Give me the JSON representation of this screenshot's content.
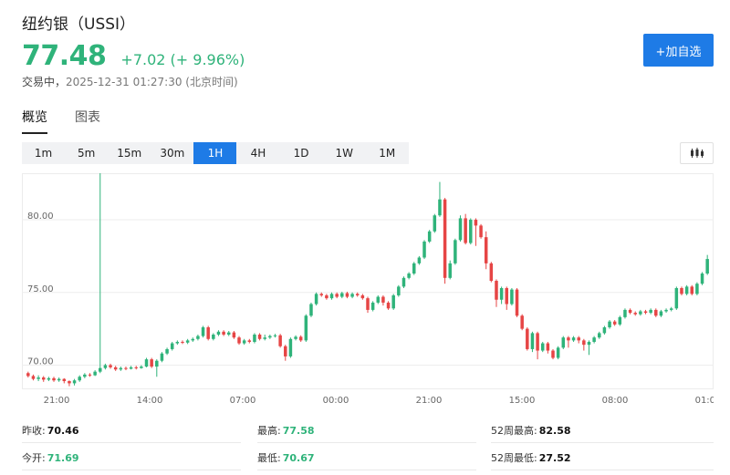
{
  "header": {
    "title": "纽约银（USSI）",
    "price": "77.48",
    "change": "+7.02 (+ 9.96%)",
    "status_label": "交易中，",
    "status_time": "2025-12-31 01:27:30 (北京时间)",
    "add_button": "+加自选"
  },
  "tabs": [
    {
      "label": "概览",
      "active": true
    },
    {
      "label": "图表",
      "active": false
    }
  ],
  "intervals": [
    "1m",
    "5m",
    "15m",
    "30m",
    "1H",
    "4H",
    "1D",
    "1W",
    "1M"
  ],
  "active_interval": "1H",
  "colors": {
    "up": "#2fb37a",
    "down": "#e64545",
    "accent": "#1e7be6"
  },
  "chart_data": {
    "type": "candlestick",
    "y_ticks": [
      "80.00",
      "75.00",
      "70.00"
    ],
    "x_ticks": [
      "21:00",
      "14:00",
      "07:00",
      "00:00",
      "21:00",
      "15:00",
      "08:00",
      "01:00"
    ],
    "ylim": [
      68.4,
      83.2
    ],
    "grid": true,
    "ohlc": [
      [
        69.45,
        69.25,
        69.55,
        69.15
      ],
      [
        69.25,
        69.05,
        69.35,
        68.95
      ],
      [
        69.05,
        69.15,
        69.3,
        68.9
      ],
      [
        69.15,
        69.0,
        69.25,
        68.85
      ],
      [
        69.0,
        69.1,
        69.2,
        68.9
      ],
      [
        69.1,
        68.95,
        69.2,
        68.85
      ],
      [
        68.95,
        69.05,
        69.15,
        68.85
      ],
      [
        69.05,
        68.9,
        69.1,
        68.75
      ],
      [
        68.9,
        68.75,
        68.95,
        68.55
      ],
      [
        68.75,
        68.95,
        69.05,
        68.6
      ],
      [
        68.95,
        69.2,
        69.3,
        68.85
      ],
      [
        69.2,
        69.35,
        69.45,
        69.1
      ],
      [
        69.35,
        69.3,
        69.45,
        69.2
      ],
      [
        69.3,
        69.55,
        69.65,
        69.25
      ],
      [
        69.55,
        69.8,
        89.9,
        69.45
      ],
      [
        69.8,
        70.0,
        70.1,
        69.7
      ],
      [
        70.0,
        69.85,
        70.1,
        69.75
      ],
      [
        69.85,
        69.7,
        69.95,
        69.6
      ],
      [
        69.7,
        69.8,
        69.9,
        69.6
      ],
      [
        69.8,
        69.75,
        69.9,
        69.65
      ],
      [
        69.75,
        69.85,
        69.95,
        69.7
      ],
      [
        69.85,
        69.8,
        69.95,
        69.7
      ],
      [
        69.8,
        69.9,
        70.0,
        69.75
      ],
      [
        69.9,
        70.4,
        70.5,
        69.85
      ],
      [
        70.4,
        69.9,
        70.5,
        69.8
      ],
      [
        69.9,
        70.3,
        70.4,
        69.2
      ],
      [
        70.3,
        70.8,
        70.9,
        70.2
      ],
      [
        70.8,
        71.1,
        71.2,
        70.7
      ],
      [
        71.1,
        71.5,
        71.6,
        71.0
      ],
      [
        71.5,
        71.6,
        71.7,
        71.4
      ],
      [
        71.6,
        71.55,
        71.7,
        71.45
      ],
      [
        71.55,
        71.7,
        71.8,
        71.45
      ],
      [
        71.7,
        71.8,
        71.9,
        71.6
      ],
      [
        71.8,
        72.0,
        72.1,
        71.7
      ],
      [
        72.0,
        72.6,
        72.7,
        71.9
      ],
      [
        72.6,
        71.8,
        72.7,
        71.7
      ],
      [
        71.8,
        72.1,
        72.2,
        71.7
      ],
      [
        72.1,
        72.3,
        72.4,
        72.0
      ],
      [
        72.3,
        72.1,
        72.4,
        72.0
      ],
      [
        72.1,
        72.25,
        72.35,
        72.0
      ],
      [
        72.25,
        71.9,
        72.35,
        71.8
      ],
      [
        71.9,
        71.5,
        72.0,
        71.4
      ],
      [
        71.5,
        71.7,
        71.8,
        71.4
      ],
      [
        71.7,
        71.6,
        71.8,
        71.5
      ],
      [
        71.6,
        72.1,
        72.2,
        71.5
      ],
      [
        72.1,
        71.8,
        72.2,
        71.7
      ],
      [
        71.8,
        71.9,
        72.1,
        71.7
      ],
      [
        71.9,
        72.0,
        72.1,
        71.8
      ],
      [
        72.0,
        72.05,
        72.15,
        71.9
      ],
      [
        72.05,
        71.3,
        72.15,
        71.2
      ],
      [
        71.3,
        70.6,
        71.4,
        70.3
      ],
      [
        70.6,
        71.8,
        71.9,
        70.5
      ],
      [
        71.8,
        71.95,
        72.05,
        71.7
      ],
      [
        71.95,
        71.7,
        72.05,
        71.6
      ],
      [
        71.7,
        73.4,
        73.5,
        71.6
      ],
      [
        73.4,
        74.2,
        74.3,
        73.3
      ],
      [
        74.2,
        74.9,
        75.0,
        74.1
      ],
      [
        74.9,
        74.8,
        75.0,
        74.7
      ],
      [
        74.8,
        74.6,
        74.9,
        74.5
      ],
      [
        74.6,
        74.9,
        75.0,
        74.5
      ],
      [
        74.9,
        74.7,
        75.0,
        74.6
      ],
      [
        74.7,
        74.95,
        75.05,
        74.6
      ],
      [
        74.95,
        74.7,
        75.05,
        74.6
      ],
      [
        74.7,
        74.9,
        75.0,
        74.6
      ],
      [
        74.9,
        74.8,
        75.0,
        74.7
      ],
      [
        74.8,
        74.6,
        74.9,
        74.5
      ],
      [
        74.6,
        73.8,
        74.7,
        73.6
      ],
      [
        73.8,
        74.3,
        74.4,
        73.7
      ],
      [
        74.3,
        74.7,
        74.8,
        74.2
      ],
      [
        74.7,
        74.3,
        74.8,
        74.1
      ],
      [
        74.3,
        73.9,
        74.4,
        73.8
      ],
      [
        73.9,
        74.8,
        74.9,
        73.8
      ],
      [
        74.8,
        75.4,
        75.5,
        74.7
      ],
      [
        75.4,
        76.0,
        76.1,
        75.3
      ],
      [
        76.0,
        76.3,
        76.4,
        75.9
      ],
      [
        76.3,
        77.0,
        77.1,
        76.2
      ],
      [
        77.0,
        77.4,
        77.5,
        76.9
      ],
      [
        77.4,
        78.5,
        78.6,
        77.3
      ],
      [
        78.5,
        79.2,
        79.3,
        78.4
      ],
      [
        79.2,
        80.3,
        80.4,
        79.1
      ],
      [
        80.3,
        81.4,
        82.6,
        80.2
      ],
      [
        81.4,
        76.0,
        81.5,
        75.6
      ],
      [
        76.0,
        77.0,
        77.2,
        75.9
      ],
      [
        77.0,
        78.6,
        78.7,
        76.9
      ],
      [
        78.6,
        80.1,
        80.3,
        78.5
      ],
      [
        80.1,
        78.4,
        80.4,
        78.3
      ],
      [
        78.4,
        80.0,
        80.1,
        78.3
      ],
      [
        80.0,
        79.6,
        80.1,
        78.2
      ],
      [
        79.6,
        78.8,
        79.7,
        78.7
      ],
      [
        78.8,
        77.0,
        79.2,
        76.6
      ],
      [
        77.0,
        75.8,
        77.1,
        75.7
      ],
      [
        75.8,
        74.5,
        75.9,
        74.0
      ],
      [
        74.5,
        75.3,
        75.4,
        74.2
      ],
      [
        75.3,
        74.2,
        75.4,
        73.8
      ],
      [
        74.2,
        75.2,
        75.3,
        74.1
      ],
      [
        75.2,
        73.4,
        75.3,
        73.3
      ],
      [
        73.4,
        72.5,
        73.5,
        72.4
      ],
      [
        72.5,
        71.1,
        72.6,
        71.0
      ],
      [
        71.1,
        72.2,
        72.3,
        70.9
      ],
      [
        72.2,
        71.0,
        72.3,
        70.4
      ],
      [
        71.0,
        71.5,
        71.6,
        70.9
      ],
      [
        71.5,
        71.0,
        71.6,
        70.8
      ],
      [
        71.0,
        70.5,
        71.1,
        70.4
      ],
      [
        70.5,
        71.2,
        71.3,
        70.4
      ],
      [
        71.2,
        71.9,
        72.0,
        71.1
      ],
      [
        71.9,
        71.7,
        72.0,
        71.2
      ],
      [
        71.7,
        71.9,
        72.0,
        71.6
      ],
      [
        71.9,
        71.7,
        72.0,
        71.5
      ],
      [
        71.7,
        71.4,
        71.8,
        71.0
      ],
      [
        71.4,
        71.6,
        71.7,
        70.7
      ],
      [
        71.6,
        71.9,
        72.0,
        71.5
      ],
      [
        71.9,
        72.2,
        72.3,
        71.8
      ],
      [
        72.2,
        72.6,
        72.7,
        72.1
      ],
      [
        72.6,
        73.0,
        73.1,
        72.5
      ],
      [
        73.0,
        72.8,
        73.1,
        72.7
      ],
      [
        72.8,
        73.3,
        73.4,
        72.7
      ],
      [
        73.3,
        73.8,
        73.9,
        73.2
      ],
      [
        73.8,
        73.6,
        73.9,
        73.5
      ],
      [
        73.6,
        73.5,
        73.7,
        73.4
      ],
      [
        73.5,
        73.7,
        73.8,
        73.4
      ],
      [
        73.7,
        73.6,
        73.8,
        73.5
      ],
      [
        73.6,
        73.8,
        73.9,
        73.5
      ],
      [
        73.8,
        73.4,
        73.9,
        73.3
      ],
      [
        73.4,
        73.7,
        73.8,
        73.3
      ],
      [
        73.7,
        73.8,
        73.9,
        73.6
      ],
      [
        73.8,
        73.9,
        74.0,
        73.7
      ],
      [
        73.9,
        75.3,
        75.4,
        73.8
      ],
      [
        75.3,
        74.9,
        75.4,
        74.8
      ],
      [
        74.9,
        75.4,
        75.5,
        74.8
      ],
      [
        75.4,
        74.9,
        75.5,
        74.8
      ],
      [
        74.9,
        75.6,
        75.7,
        74.8
      ],
      [
        75.6,
        76.3,
        76.4,
        75.5
      ],
      [
        76.3,
        77.3,
        77.58,
        76.2
      ]
    ]
  },
  "stats": {
    "prev_close_label": "昨收:",
    "prev_close": "70.46",
    "open_label": "今开:",
    "open": "71.69",
    "high_label": "最高:",
    "high": "77.58",
    "low_label": "最低:",
    "low": "70.67",
    "w52_high_label": "52周最高:",
    "w52_high": "82.58",
    "w52_low_label": "52周最低:",
    "w52_low": "27.52"
  }
}
